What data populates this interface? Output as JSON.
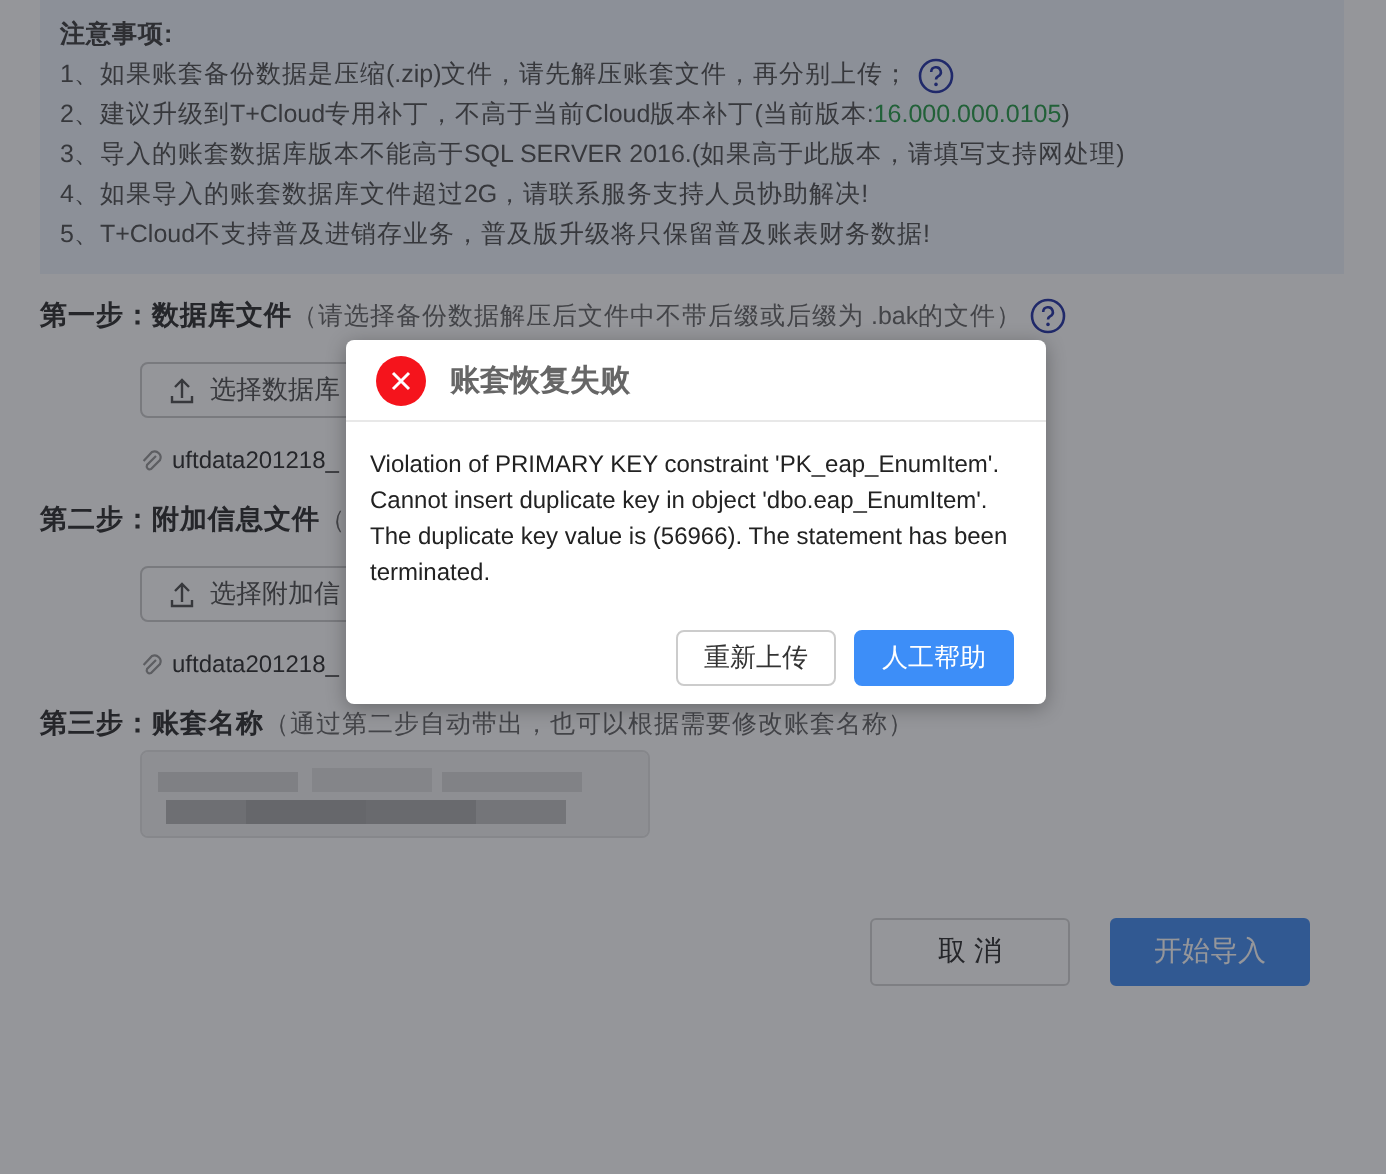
{
  "notice": {
    "title": "注意事项:",
    "items": [
      {
        "text": "1、如果账套备份数据是压缩(.zip)文件，请先解压账套文件，再分别上传；",
        "help": true
      },
      {
        "text": "2、建议升级到T+Cloud专用补丁，不高于当前Cloud版本补丁(当前版本:",
        "version": "16.000.000.0105",
        "suffix": ")",
        "help": false
      },
      {
        "text": "3、导入的账套数据库版本不能高于SQL SERVER 2016.(如果高于此版本，请填写支持网处理)",
        "help": false
      },
      {
        "text": "4、如果导入的账套数据库文件超过2G，请联系服务支持人员协助解决!",
        "help": false
      },
      {
        "text": "5、T+Cloud不支持普及进销存业务，普及版升级将只保留普及账表财务数据!",
        "help": false
      }
    ]
  },
  "steps": [
    {
      "kind": "file",
      "label": "第一步：数据库文件",
      "hint": "（请选择备份数据解压后文件中不带后缀或后缀为 .bak的文件）",
      "help": true,
      "button": "选择数据库",
      "file": "uftdata201218_"
    },
    {
      "kind": "file",
      "label": "第二步：附加信息文件",
      "hint": "（",
      "button": "选择附加信",
      "file": "uftdata201218_"
    },
    {
      "kind": "name",
      "label": "第三步：账套名称",
      "hint": "（通过第二步自动带出，也可以根据需要修改账套名称）",
      "help": false
    }
  ],
  "actions": [
    {
      "label": "取 消",
      "primary": false
    },
    {
      "label": "开始导入",
      "primary": true
    }
  ],
  "dialog": {
    "title": "账套恢复失败",
    "message": "Violation of PRIMARY KEY constraint 'PK_eap_EnumItem'. Cannot insert duplicate key in object 'dbo.eap_EnumItem'. The duplicate key value is (56966). The statement has been terminated.",
    "buttons": [
      {
        "label": "重新上传",
        "primary": false
      },
      {
        "label": "人工帮助",
        "primary": true
      }
    ]
  }
}
